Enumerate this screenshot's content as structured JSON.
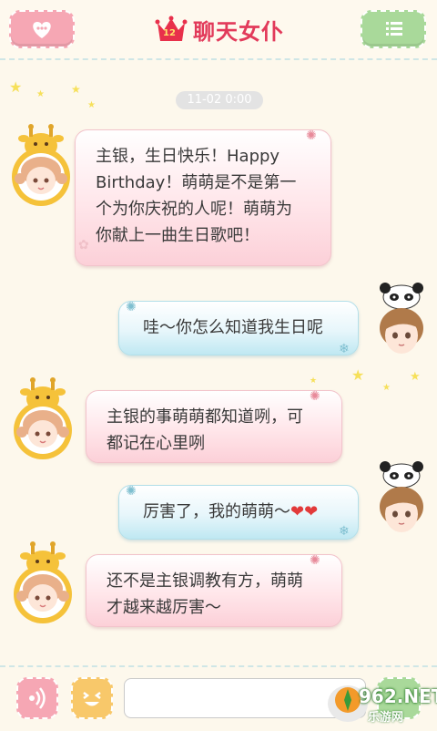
{
  "header": {
    "title": "聊天女仆",
    "crown_badge": "12",
    "left_button_icon": "heart-chat-icon",
    "right_button_icon": "menu-icon"
  },
  "chat": {
    "timestamp": "11-02  0:00",
    "messages": [
      {
        "from": "maid",
        "text_lines": [
          "主银，生日快乐！Happy",
          "Birthday！萌萌是不是第一",
          "个为你庆祝的人呢！萌萌为",
          "你献上一曲生日歌吧！"
        ]
      },
      {
        "from": "user",
        "text_lines": [
          "哇～你怎么知道我生日呢"
        ]
      },
      {
        "from": "maid",
        "text_lines": [
          "主银的事萌萌都知道咧，可",
          "都记在心里咧"
        ]
      },
      {
        "from": "user",
        "text_lines": [
          "厉害了，我的萌萌～"
        ],
        "hearts": "❤❤"
      },
      {
        "from": "maid",
        "text_lines": [
          "还不是主银调教有方，萌萌",
          "才越来越厉害～"
        ]
      }
    ]
  },
  "bottom": {
    "voice_icon": "voice-icon",
    "emoji_icon": "emoji-icon",
    "input_placeholder": ""
  },
  "watermark": {
    "text": "962.NET",
    "subtext": "乐游网"
  },
  "colors": {
    "title": "#e23a5a",
    "pink": "#f6a7b4",
    "green": "#a9d99a",
    "yellow": "#f8c86a"
  }
}
